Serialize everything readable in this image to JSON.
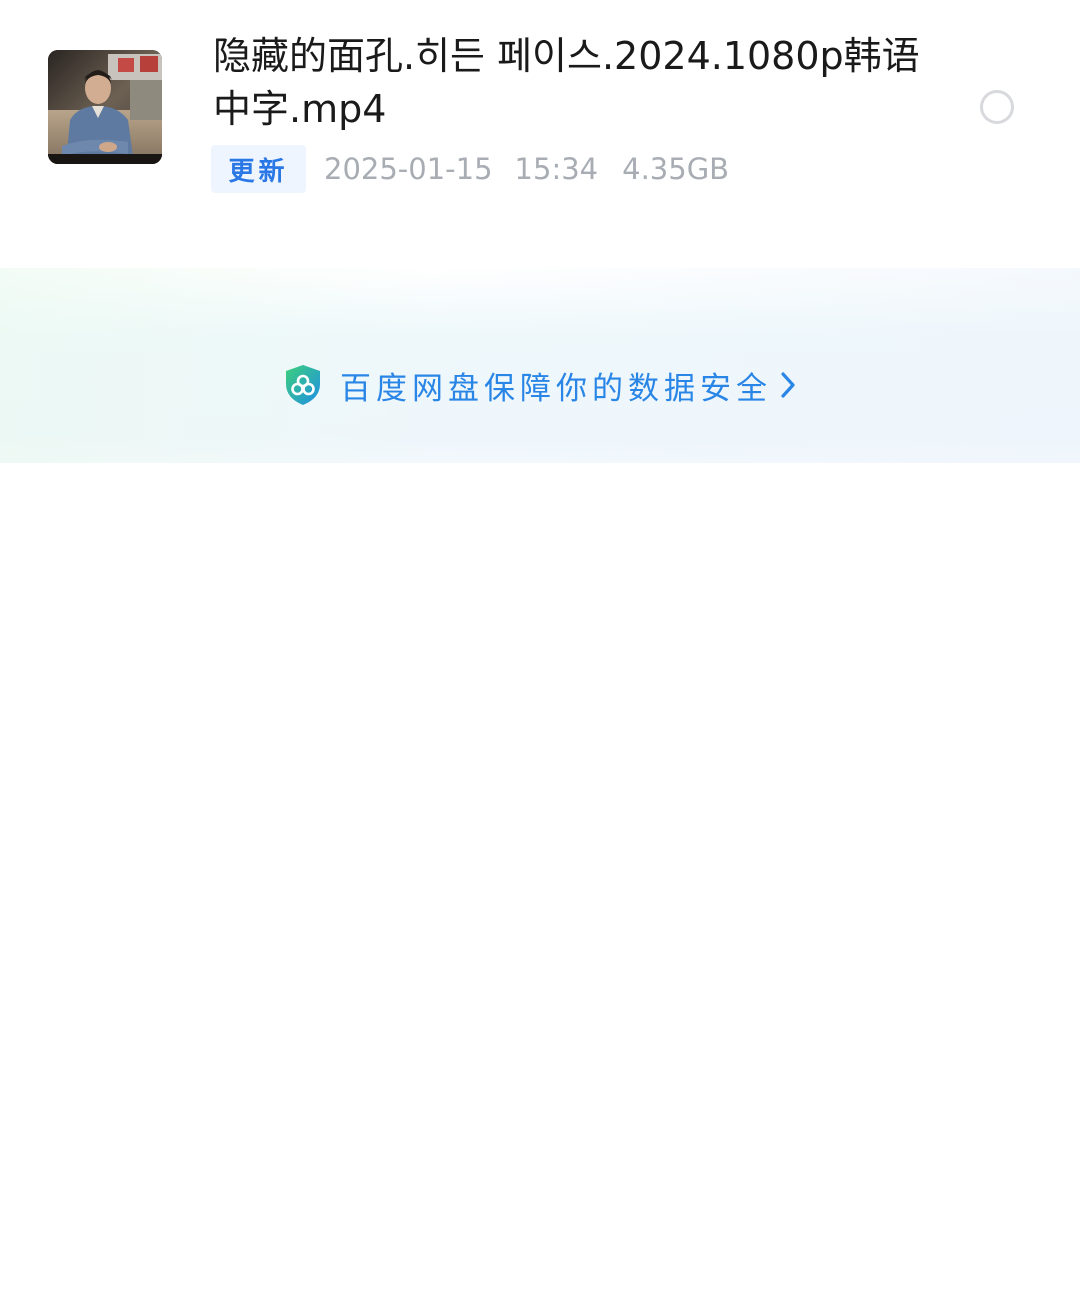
{
  "file": {
    "name": "隐藏的面孔.히든 페이스.2024.1080p韩语中字.mp4",
    "badge": "更新",
    "date": "2025-01-15",
    "time": "15:34",
    "size": "4.35GB",
    "thumbnail": "video-thumbnail-man-seated",
    "selected": false
  },
  "security_banner": {
    "text": "百度网盘保障你的数据安全",
    "icon": "shield-icon",
    "accent_color": "#2a86e6"
  }
}
